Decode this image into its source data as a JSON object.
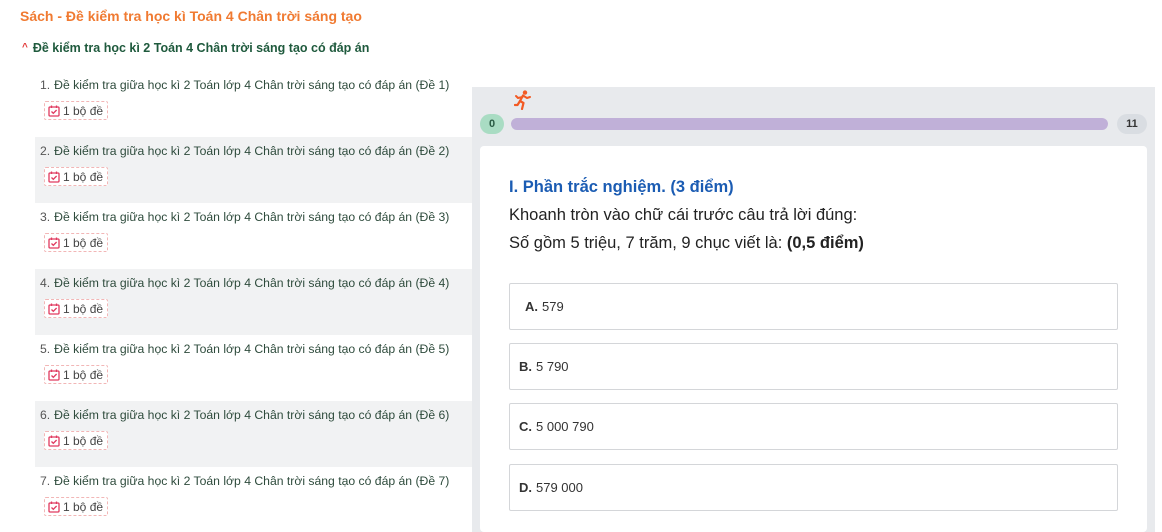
{
  "book_title": "Sách - Đề kiểm tra học kì Toán 4 Chân trời sáng tạo",
  "section": {
    "title": "Đề kiểm tra học kì 2 Toán 4 Chân trời sáng tạo có đáp án"
  },
  "exam_list": [
    {
      "num": "1.",
      "title": "Đề kiểm tra giữa học kì 2 Toán lớp 4 Chân trời sáng tạo có đáp án (Đề 1)",
      "badge": "1 bộ đề"
    },
    {
      "num": "2.",
      "title": "Đề kiểm tra giữa học kì 2 Toán lớp 4 Chân trời sáng tạo có đáp án (Đề 2)",
      "badge": "1 bộ đề"
    },
    {
      "num": "3.",
      "title": "Đề kiểm tra giữa học kì 2 Toán lớp 4 Chân trời sáng tạo có đáp án (Đề 3)",
      "badge": "1 bộ đề"
    },
    {
      "num": "4.",
      "title": "Đề kiểm tra giữa học kì 2 Toán lớp 4 Chân trời sáng tạo có đáp án (Đề 4)",
      "badge": "1 bộ đề"
    },
    {
      "num": "5.",
      "title": "Đề kiểm tra giữa học kì 2 Toán lớp 4 Chân trời sáng tạo có đáp án (Đề 5)",
      "badge": "1 bộ đề"
    },
    {
      "num": "6.",
      "title": "Đề kiểm tra giữa học kì 2 Toán lớp 4 Chân trời sáng tạo có đáp án (Đề 6)",
      "badge": "1 bộ đề"
    },
    {
      "num": "7.",
      "title": "Đề kiểm tra giữa học kì 2 Toán lớp 4 Chân trời sáng tạo có đáp án (Đề 7)",
      "badge": "1 bộ đề"
    }
  ],
  "quiz": {
    "runner_icon": "running-person-icon",
    "progress": {
      "start": "0",
      "end": "11",
      "fraction": 0
    },
    "section_heading": "I. Phần trắc nghiệm. (3 điểm)",
    "instruction": "Khoanh tròn vào chữ cái trước câu trả lời đúng:",
    "question_text": "Số gồm 5 triệu, 7 trăm, 9 chục viết là:",
    "question_points": "(0,5 điểm)",
    "options": [
      {
        "letter": "A.",
        "text": "579"
      },
      {
        "letter": "B.",
        "text": "5 790"
      },
      {
        "letter": "C.",
        "text": "5 000 790"
      },
      {
        "letter": "D.",
        "text": "579 000"
      }
    ]
  },
  "colors": {
    "book_title": "#f07a31",
    "heading_blue": "#1b5cb3",
    "badge_icon": "#e03a5f",
    "progress_track": "#c0b0d8"
  }
}
